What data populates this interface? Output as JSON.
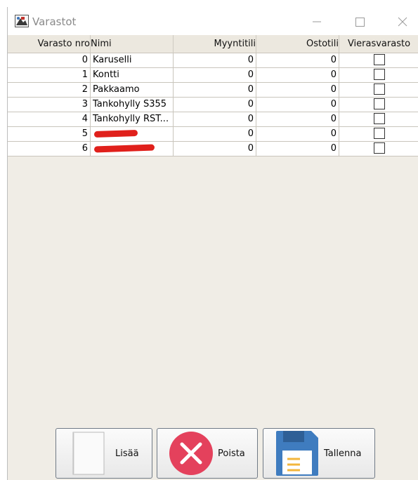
{
  "window": {
    "title": "Varastot"
  },
  "table": {
    "columns": [
      "Varasto nro",
      "Nimi",
      "Myyntitili",
      "Ostotili",
      "Vierasvarasto"
    ],
    "rows": [
      {
        "nro": "0",
        "nimi": "Karuselli",
        "myynti": "0",
        "osto": "0",
        "vieras": false
      },
      {
        "nro": "1",
        "nimi": "Kontti",
        "myynti": "0",
        "osto": "0",
        "vieras": false
      },
      {
        "nro": "2",
        "nimi": "Pakkaamo",
        "myynti": "0",
        "osto": "0",
        "vieras": false
      },
      {
        "nro": "3",
        "nimi": "Tankohylly S355",
        "myynti": "0",
        "osto": "0",
        "vieras": false
      },
      {
        "nro": "4",
        "nimi": "Tankohylly RST...",
        "myynti": "0",
        "osto": "0",
        "vieras": false
      },
      {
        "nro": "5",
        "nimi": "",
        "myynti": "0",
        "osto": "0",
        "vieras": false
      },
      {
        "nro": "6",
        "nimi": "",
        "myynti": "0",
        "osto": "0",
        "vieras": false
      }
    ]
  },
  "buttons": {
    "add": "Lisää",
    "delete": "Poista",
    "save": "Tallenna"
  },
  "colors": {
    "delete_red": "#e4415c",
    "save_blue": "#3f7cbf",
    "redaction": "#e0201b"
  }
}
